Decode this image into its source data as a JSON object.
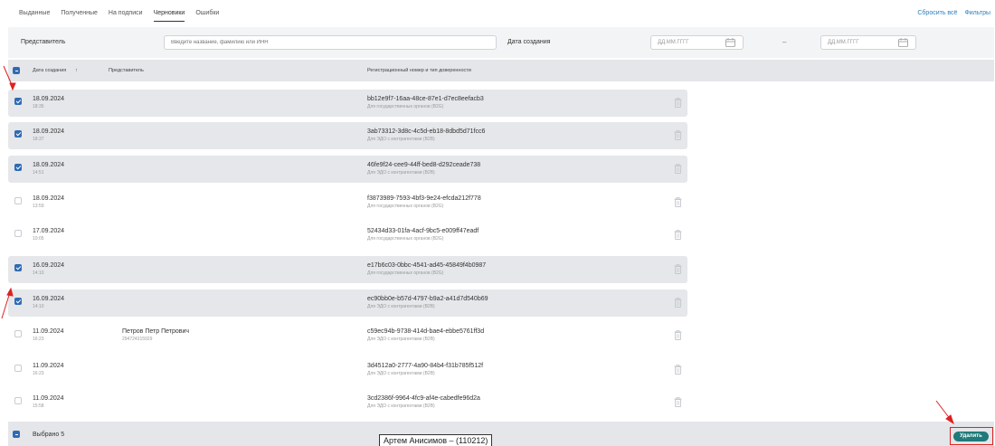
{
  "tabs": [
    {
      "label": "Выданные"
    },
    {
      "label": "Полученные"
    },
    {
      "label": "На подписи"
    },
    {
      "label": "Черновики",
      "active": true
    },
    {
      "label": "Ошибки"
    }
  ],
  "top_links": {
    "reset": "Сбросить всё",
    "filters": "Фильтры"
  },
  "filters": {
    "representative_label": "Представитель",
    "search_placeholder": "Введите название, фамилию или ИНН",
    "created_label": "Дата создания",
    "date_from_placeholder": "ДД.ММ.ГГГГ",
    "date_to_placeholder": "ДД.ММ.ГГГГ",
    "dash": "–"
  },
  "table": {
    "headers": {
      "date": "Дата создания",
      "sort": "↑",
      "representative": "Представитель",
      "reg": "Регистрационный номер и тип доверенности"
    },
    "rows": [
      {
        "date": "18.09.2024",
        "time": "18:35",
        "rep": "",
        "inn": "",
        "reg": "bb12e9f7-16aa-48ce-87e1-d7ec8eefacb3",
        "type": "Для государственных органов (B2G)",
        "selected": true
      },
      {
        "date": "18.09.2024",
        "time": "18:37",
        "rep": "",
        "inn": "",
        "reg": "3ab73312-3d8c-4c5d-eb18-8dbd5d71fcc6",
        "type": "Для ЭДО с контрагентами (B2B)",
        "selected": true
      },
      {
        "date": "18.09.2024",
        "time": "14:51",
        "rep": "",
        "inn": "",
        "reg": "46fe9f24-cee9-44ff-bed8-d292ceade738",
        "type": "Для ЭДО с контрагентами (B2B)",
        "selected": true
      },
      {
        "date": "18.09.2024",
        "time": "13:59",
        "rep": "",
        "inn": "",
        "reg": "f3873989-7593-4bf3-9e24-efcda212f778",
        "type": "Для государственных органов (B2G)",
        "selected": false
      },
      {
        "date": "17.09.2024",
        "time": "10:05",
        "rep": "",
        "inn": "",
        "reg": "52434d33-01fa-4acf-9bc5-e009ff47eadf",
        "type": "Для государственных органов (B2G)",
        "selected": false
      },
      {
        "date": "16.09.2024",
        "time": "14:10",
        "rep": "",
        "inn": "",
        "reg": "e17b6c03-0bbc-4541-ad45-45849f4b0987",
        "type": "Для государственных органов (B2G)",
        "selected": true
      },
      {
        "date": "16.09.2024",
        "time": "14:10",
        "rep": "",
        "inn": "",
        "reg": "ec90bb0e-b57d-4797-b9a2-a41d7d540b69",
        "type": "Для ЭДО с контрагентами (B2B)",
        "selected": true
      },
      {
        "date": "11.09.2024",
        "time": "16:23",
        "rep": "Петров Петр Петрович",
        "inn": "294724315929",
        "reg": "c59ec94b-9738-414d-bae4-ebbe5761ff3d",
        "type": "Для ЭДО с контрагентами (B2B)",
        "selected": false
      },
      {
        "date": "11.09.2024",
        "time": "16:23",
        "rep": "",
        "inn": "",
        "reg": "3d4512a0-2777-4a90-84b4-f31b785f512f",
        "type": "Для ЭДО с контрагентами (B2B)",
        "selected": false
      },
      {
        "date": "11.09.2024",
        "time": "15:58",
        "rep": "",
        "inn": "",
        "reg": "3cd2386f-9964-4fc9-af4e-cabedfe96d2a",
        "type": "Для ЭДО с контрагентами (B2B)",
        "selected": false
      }
    ]
  },
  "footer": {
    "selected_text": "Выбрано 5",
    "tooltip": "Артем Анисимов – (110212)",
    "delete_label": "Удалить"
  },
  "colors": {
    "accent": "#2f6bb3",
    "delete": "#1f7a7a",
    "highlight": "#dd2222"
  }
}
